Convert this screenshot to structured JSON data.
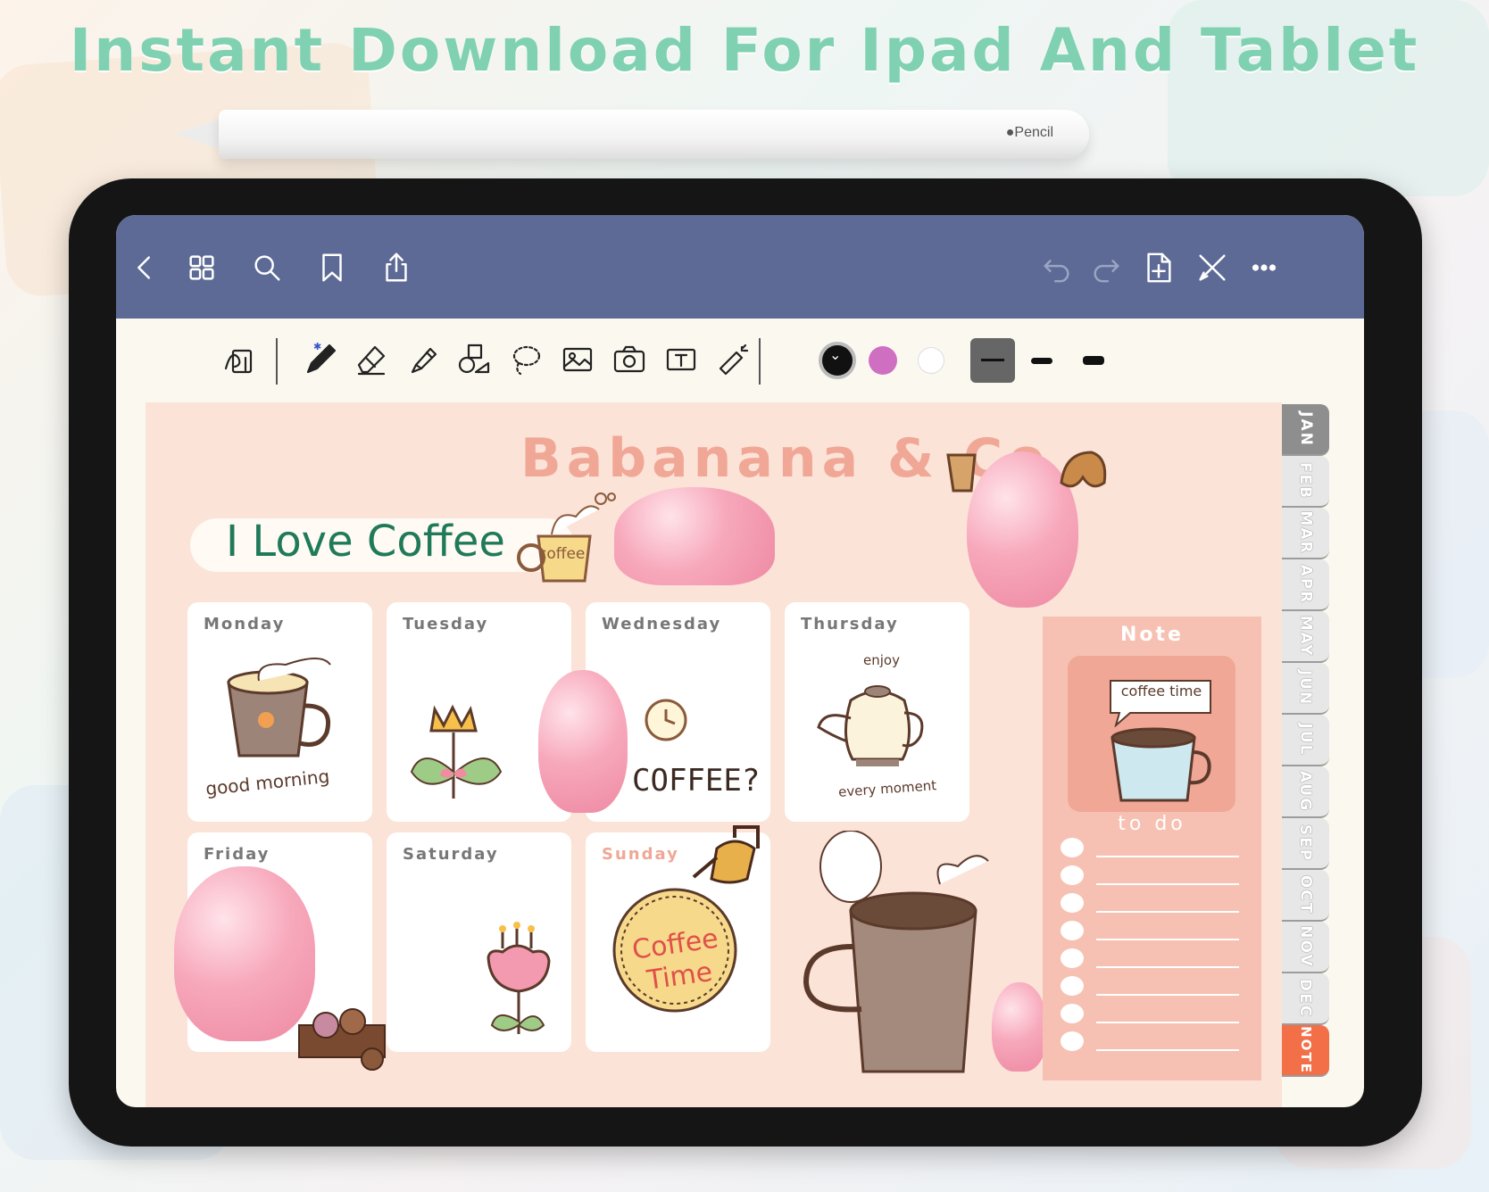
{
  "headline": "Instant Download For Ipad And Tablet",
  "pencil": {
    "brand": "Pencil"
  },
  "navbar": {
    "buttons": [
      "back-icon",
      "grid-icon",
      "search-icon",
      "bookmark-icon",
      "share-icon",
      "undo-icon",
      "redo-icon",
      "add-page-icon",
      "close-icon",
      "more-icon"
    ]
  },
  "toolbar": {
    "tools": [
      "handwriting-convert-icon",
      "pen-icon",
      "eraser-icon",
      "highlighter-icon",
      "shapes-icon",
      "lasso-icon",
      "image-icon",
      "camera-icon",
      "text-icon",
      "laser-pointer-icon"
    ],
    "colors": {
      "selected": "#111111",
      "pink": "#cf6fc2",
      "white": "#ffffff"
    }
  },
  "planner": {
    "brand": "Babanana & Co",
    "banner": "I Love Coffee",
    "cup_label": "coffee",
    "days": [
      "Monday",
      "Tuesday",
      "Wednesday",
      "Thursday",
      "Friday",
      "Saturday",
      "Sunday"
    ],
    "monday_art": "good morning",
    "wednesday_art": "COFFEE?",
    "thursday_art_top": "enjoy",
    "thursday_art_bottom": "every moment",
    "sunday_art": "Coffee Time",
    "note_title": "Note",
    "note_bubble": "coffee time",
    "todo_title": "to do",
    "todo_count": 8,
    "months": [
      "JAN",
      "FEB",
      "MAR",
      "APR",
      "MAY",
      "JUN",
      "JUL",
      "AUG",
      "SEP",
      "OCT",
      "NOV",
      "DEC",
      "NOTE"
    ]
  },
  "colors": {
    "headline": "#7fd1b2",
    "navbar": "#5c6a95",
    "page_bg": "#fbe3d8",
    "brand": "#f0a796",
    "banner_text": "#1f7a5a",
    "note_panel": "#f6c1b2",
    "note_tab": "#f26f48"
  }
}
